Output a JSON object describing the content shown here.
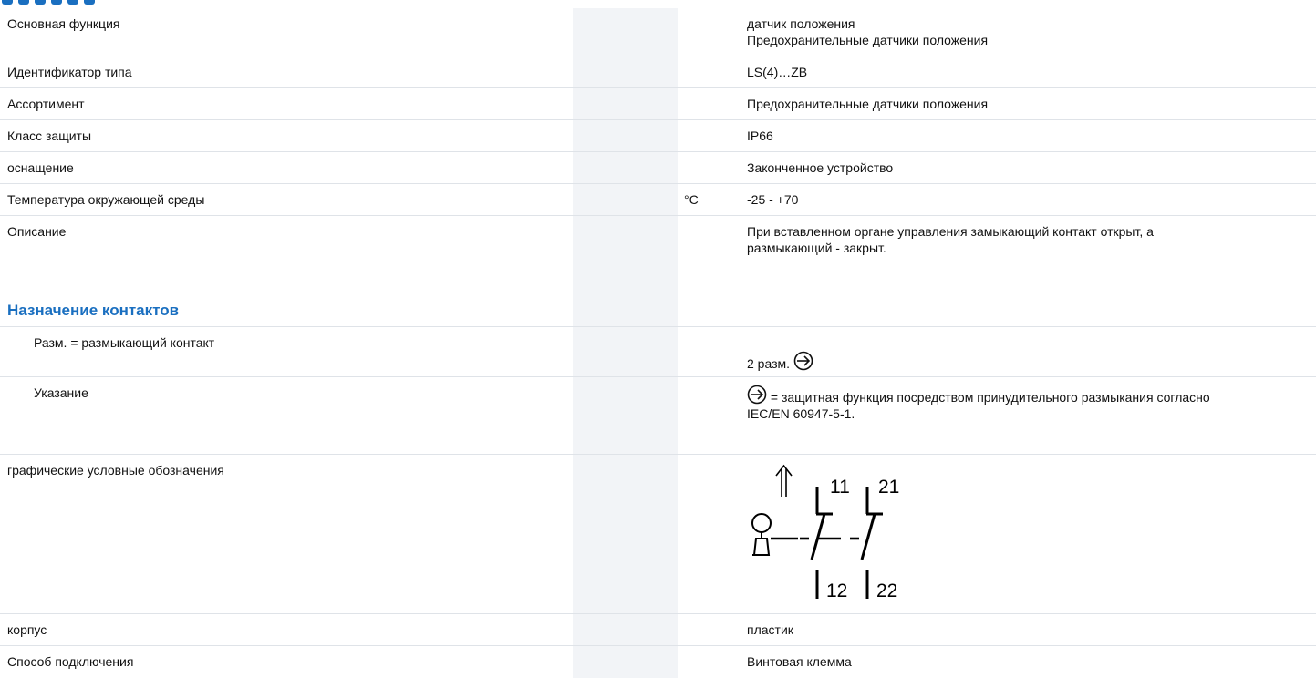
{
  "section_title": "Назначение контактов",
  "rows": [
    {
      "label": "Основная функция",
      "unit": "",
      "value": "датчик положения\nПредохранительные датчики положения"
    },
    {
      "label": "Идентификатор типа",
      "unit": "",
      "value": "LS(4)…ZB"
    },
    {
      "label": "Ассортимент",
      "unit": "",
      "value": "Предохранительные датчики положения"
    },
    {
      "label": "Класс защиты",
      "unit": "",
      "value": "IP66"
    },
    {
      "label": "оснащение",
      "unit": "",
      "value": "Законченное устройство"
    },
    {
      "label": "Температура окружающей среды",
      "unit": "°C",
      "value": "-25 - +70"
    },
    {
      "label": "Описание",
      "unit": "",
      "value": "При вставленном органе управления замыкающий контакт открыт, а\nразмыкающий - закрыт."
    }
  ],
  "contacts": {
    "nc_label": "Разм. = размыкающий контакт",
    "nc_value": "2 разм.",
    "note_label": "Указание",
    "note_value_line1": " = защитная функция посредством принудительного размыкания согласно",
    "note_value_line2": "IEC/EN 60947-5-1."
  },
  "symbol_row": {
    "label": "графические условные обозначения",
    "terminals": [
      "11",
      "21",
      "12",
      "22"
    ]
  },
  "rows_bottom": [
    {
      "label": "корпус",
      "value": "пластик"
    },
    {
      "label": "Способ подключения",
      "value": "Винтовая клемма"
    }
  ],
  "colors": {
    "accent": "#1a6fc0",
    "shade": "#f2f4f7",
    "border": "#dfe3e8"
  }
}
